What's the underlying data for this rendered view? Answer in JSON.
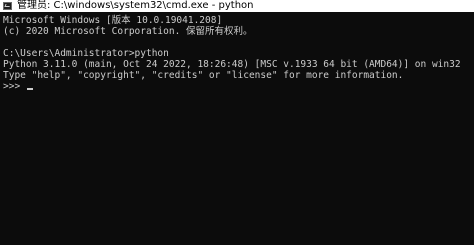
{
  "window": {
    "title": "管理员: C:\\windows\\system32\\cmd.exe - python",
    "icon": "cmd-icon"
  },
  "console": {
    "lines": [
      "Microsoft Windows [版本 10.0.19041.208]",
      "(c) 2020 Microsoft Corporation. 保留所有权利。",
      "",
      "C:\\Users\\Administrator>python",
      "Python 3.11.0 (main, Oct 24 2022, 18:26:48) [MSC v.1933 64 bit (AMD64)] on win32",
      "Type \"help\", \"copyright\", \"credits\" or \"license\" for more information.",
      ">>> "
    ]
  },
  "colors": {
    "console_bg": "#0c0c0c",
    "console_fg": "#cccccc",
    "titlebar_bg": "#ffffff"
  }
}
